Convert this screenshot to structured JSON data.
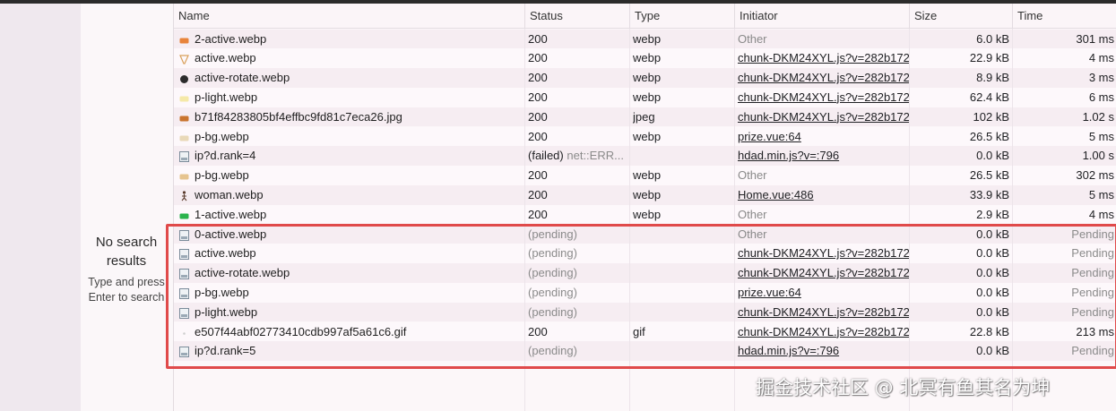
{
  "search_panel": {
    "no_results_title": "No search results",
    "no_results_hint": "Type and press Enter to search"
  },
  "columns": [
    "Name",
    "Status",
    "Type",
    "Initiator",
    "Size",
    "Time"
  ],
  "requests": [
    {
      "name": "2-active.webp",
      "status": "200",
      "status_sub": "",
      "type": "webp",
      "initiator": "Other",
      "initiator_kind": "other",
      "size": "6.0 kB",
      "time": "301 ms",
      "icon": "orange-image-icon",
      "icon_color": "#e8833a"
    },
    {
      "name": "active.webp",
      "status": "200",
      "status_sub": "",
      "type": "webp",
      "initiator": "chunk-DKM24XYL.js?v=282b172",
      "initiator_kind": "link",
      "size": "22.9 kB",
      "time": "4 ms",
      "icon": "funnel-image-icon",
      "icon_color": "#d9a05b"
    },
    {
      "name": "active-rotate.webp",
      "status": "200",
      "status_sub": "",
      "type": "webp",
      "initiator": "chunk-DKM24XYL.js?v=282b172",
      "initiator_kind": "link",
      "size": "8.9 kB",
      "time": "3 ms",
      "icon": "dark-image-icon",
      "icon_color": "#2b2b2b"
    },
    {
      "name": "p-light.webp",
      "status": "200",
      "status_sub": "",
      "type": "webp",
      "initiator": "chunk-DKM24XYL.js?v=282b172",
      "initiator_kind": "link",
      "size": "62.4 kB",
      "time": "6 ms",
      "icon": "light-image-icon",
      "icon_color": "#f5e9a8"
    },
    {
      "name": "b71f84283805bf4effbc9fd81c7eca26.jpg",
      "status": "200",
      "status_sub": "",
      "type": "jpeg",
      "initiator": "chunk-DKM24XYL.js?v=282b172",
      "initiator_kind": "link",
      "size": "102 kB",
      "time": "1.02 s",
      "icon": "photo-image-icon",
      "icon_color": "#c9742e"
    },
    {
      "name": "p-bg.webp",
      "status": "200",
      "status_sub": "",
      "type": "webp",
      "initiator": "prize.vue:64",
      "initiator_kind": "link",
      "size": "26.5 kB",
      "time": "5 ms",
      "icon": "beige-image-icon",
      "icon_color": "#e9d9b8"
    },
    {
      "name": "ip?d.rank=4",
      "status": "(failed)",
      "status_sub": "net::ERR...",
      "type": "",
      "initiator": "hdad.min.js?v=:796",
      "initiator_kind": "link",
      "size": "0.0 kB",
      "time": "1.00 s",
      "icon": "document-icon",
      "icon_color": "#7a8b99"
    },
    {
      "name": "p-bg.webp",
      "status": "200",
      "status_sub": "",
      "type": "webp",
      "initiator": "Other",
      "initiator_kind": "other",
      "size": "26.5 kB",
      "time": "302 ms",
      "icon": "beige-image-icon",
      "icon_color": "#e6c48f"
    },
    {
      "name": "woman.webp",
      "status": "200",
      "status_sub": "",
      "type": "webp",
      "initiator": "Home.vue:486",
      "initiator_kind": "link",
      "size": "33.9 kB",
      "time": "5 ms",
      "icon": "figure-image-icon",
      "icon_color": "#5a3b2c"
    },
    {
      "name": "1-active.webp",
      "status": "200",
      "status_sub": "",
      "type": "webp",
      "initiator": "Other",
      "initiator_kind": "other",
      "size": "2.9 kB",
      "time": "4 ms",
      "icon": "green-image-icon",
      "icon_color": "#2bb24c"
    },
    {
      "name": "0-active.webp",
      "status": "(pending)",
      "status_sub": "",
      "type": "",
      "initiator": "Other",
      "initiator_kind": "other",
      "size": "0.0 kB",
      "time": "Pending",
      "icon": "document-icon",
      "icon_color": "#7a8b99"
    },
    {
      "name": "active.webp",
      "status": "(pending)",
      "status_sub": "",
      "type": "",
      "initiator": "chunk-DKM24XYL.js?v=282b172",
      "initiator_kind": "link",
      "size": "0.0 kB",
      "time": "Pending",
      "icon": "document-icon",
      "icon_color": "#7a8b99"
    },
    {
      "name": "active-rotate.webp",
      "status": "(pending)",
      "status_sub": "",
      "type": "",
      "initiator": "chunk-DKM24XYL.js?v=282b172",
      "initiator_kind": "link",
      "size": "0.0 kB",
      "time": "Pending",
      "icon": "document-icon",
      "icon_color": "#7a8b99"
    },
    {
      "name": "p-bg.webp",
      "status": "(pending)",
      "status_sub": "",
      "type": "",
      "initiator": "prize.vue:64",
      "initiator_kind": "link",
      "size": "0.0 kB",
      "time": "Pending",
      "icon": "document-icon",
      "icon_color": "#7a8b99"
    },
    {
      "name": "p-light.webp",
      "status": "(pending)",
      "status_sub": "",
      "type": "",
      "initiator": "chunk-DKM24XYL.js?v=282b172",
      "initiator_kind": "link",
      "size": "0.0 kB",
      "time": "Pending",
      "icon": "document-icon",
      "icon_color": "#7a8b99"
    },
    {
      "name": "e507f44abf02773410cdb997af5a61c6.gif",
      "status": "200",
      "status_sub": "",
      "type": "gif",
      "initiator": "chunk-DKM24XYL.js?v=282b172",
      "initiator_kind": "link",
      "size": "22.8 kB",
      "time": "213 ms",
      "icon": "dot-image-icon",
      "icon_color": "#cfcfcf"
    },
    {
      "name": "ip?d.rank=5",
      "status": "(pending)",
      "status_sub": "",
      "type": "",
      "initiator": "hdad.min.js?v=:796",
      "initiator_kind": "link",
      "size": "0.0 kB",
      "time": "Pending",
      "icon": "document-icon",
      "icon_color": "#7a8b99"
    }
  ],
  "watermark": "掘金技术社区 @ 北冥有鱼其名为坤",
  "colors": {
    "highlight_border": "#e04a4a",
    "link": "#202124",
    "muted": "#8b8b8b"
  }
}
